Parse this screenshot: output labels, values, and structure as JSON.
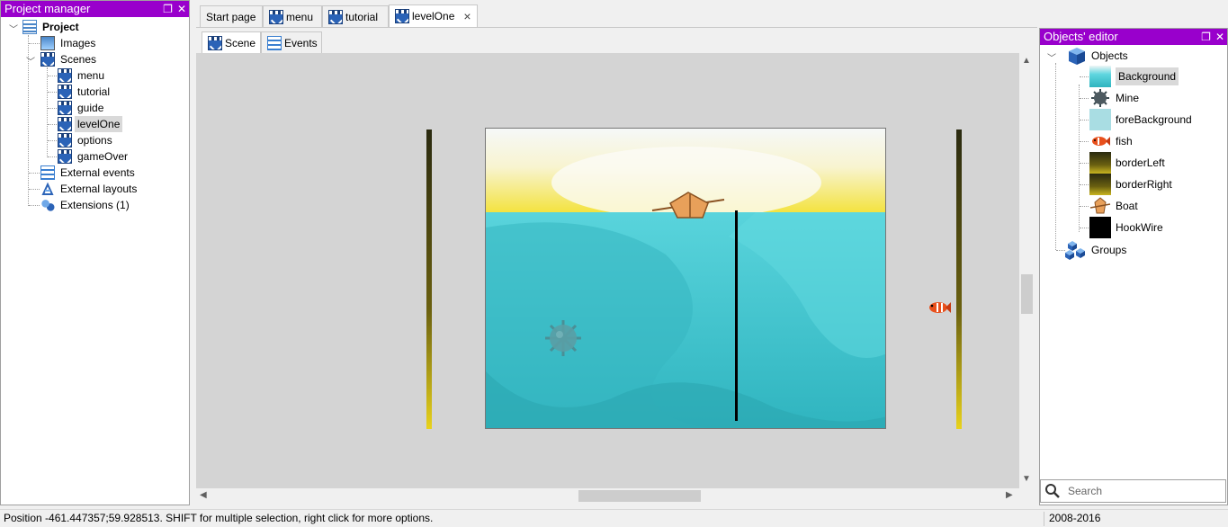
{
  "project_manager": {
    "title": "Project manager",
    "float_icon": "❐",
    "close_icon": "✕",
    "tree": {
      "project": "Project",
      "images": "Images",
      "scenes": "Scenes",
      "scene_items": [
        "menu",
        "tutorial",
        "guide",
        "levelOne",
        "options",
        "gameOver"
      ],
      "selected_scene": "levelOne",
      "external_events": "External events",
      "external_layouts": "External layouts",
      "extensions": "Extensions (1)"
    }
  },
  "tabs": [
    {
      "label": "Start page"
    },
    {
      "label": "menu"
    },
    {
      "label": "tutorial"
    },
    {
      "label": "levelOne",
      "active": true
    }
  ],
  "subtabs": [
    {
      "label": "Scene",
      "active": true
    },
    {
      "label": "Events"
    }
  ],
  "objects_editor": {
    "title": "Objects' editor",
    "root": "Objects",
    "objects": [
      {
        "name": "Background",
        "selected": true,
        "icon": "background-thumb"
      },
      {
        "name": "Mine",
        "icon": "mine-thumb"
      },
      {
        "name": "foreBackground",
        "icon": "forebackground-thumb"
      },
      {
        "name": "fish",
        "icon": "fish-thumb"
      },
      {
        "name": "borderLeft",
        "icon": "border-thumb"
      },
      {
        "name": "borderRight",
        "icon": "border-thumb"
      },
      {
        "name": "Boat",
        "icon": "boat-thumb"
      },
      {
        "name": "HookWire",
        "icon": "hookwire-thumb"
      }
    ],
    "groups": "Groups",
    "search_placeholder": "Search"
  },
  "status": {
    "message": "Position -461.447357;59.928513. SHIFT for multiple selection, right click for more options.",
    "copyright": "2008-2016"
  },
  "colors": {
    "panel_title": "#9900cc",
    "scene_bg": "#d4d4d4",
    "water": "#4fcad3",
    "sky_yellow": "#f5e84a"
  }
}
